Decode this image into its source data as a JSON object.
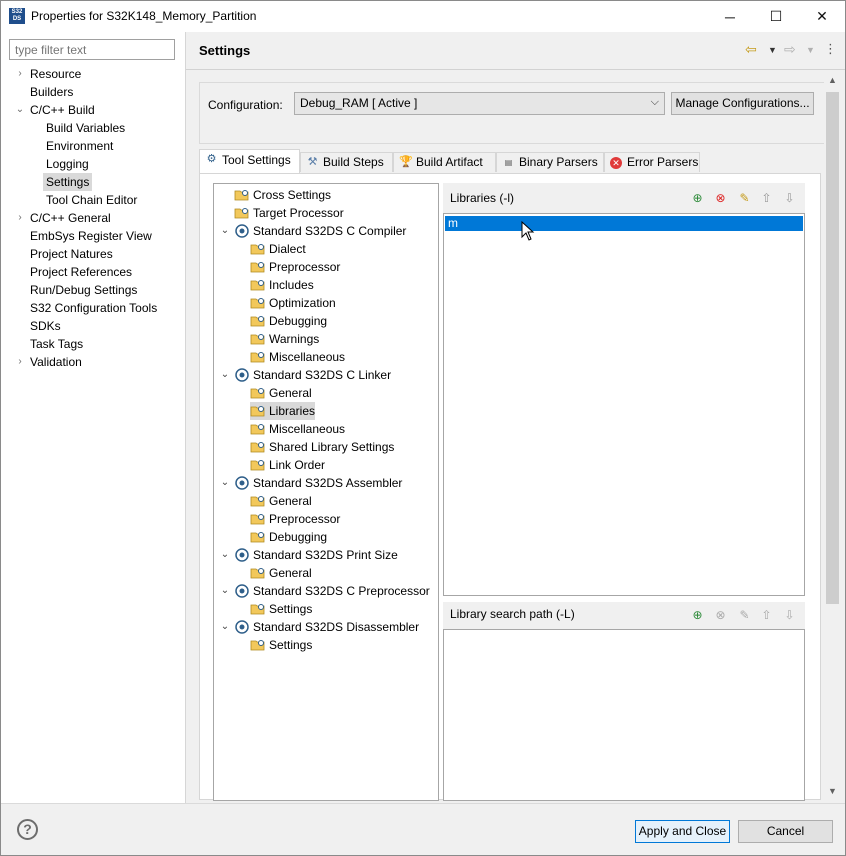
{
  "window": {
    "title": "Properties for S32K148_Memory_Partition",
    "app_icon_text": "S32 DS",
    "minimize": "─",
    "maximize": "☐",
    "close": "✕"
  },
  "filter": {
    "placeholder": "type filter text"
  },
  "sidebar": {
    "items": [
      {
        "label": "Resource",
        "expander": "right"
      },
      {
        "label": "Builders"
      },
      {
        "label": "C/C++ Build",
        "expander": "down"
      },
      {
        "label": "Build Variables"
      },
      {
        "label": "Environment"
      },
      {
        "label": "Logging"
      },
      {
        "label": "Settings",
        "selected": true
      },
      {
        "label": "Tool Chain Editor"
      },
      {
        "label": "C/C++ General",
        "expander": "right"
      },
      {
        "label": "EmbSys Register View"
      },
      {
        "label": "Project Natures"
      },
      {
        "label": "Project References"
      },
      {
        "label": "Run/Debug Settings"
      },
      {
        "label": "S32 Configuration Tools"
      },
      {
        "label": "SDKs"
      },
      {
        "label": "Task Tags"
      },
      {
        "label": "Validation",
        "expander": "right"
      }
    ]
  },
  "header": {
    "title": "Settings"
  },
  "config": {
    "label": "Configuration:",
    "value": "Debug_RAM  [ Active ]",
    "manage_label": "Manage Configurations..."
  },
  "tabs": [
    {
      "label": "Tool Settings",
      "icon": "tool-settings-icon",
      "active": true
    },
    {
      "label": "Build Steps",
      "icon": "build-steps-icon"
    },
    {
      "label": "Build Artifact",
      "icon": "build-artifact-icon"
    },
    {
      "label": "Binary Parsers",
      "icon": "binary-parsers-icon"
    },
    {
      "label": "Error Parsers",
      "icon": "error-parsers-icon"
    }
  ],
  "tool_tree": [
    {
      "label": "Cross Settings"
    },
    {
      "label": "Target Processor"
    },
    {
      "label": "Standard S32DS C Compiler",
      "expander": "down"
    },
    {
      "label": "Dialect"
    },
    {
      "label": "Preprocessor"
    },
    {
      "label": "Includes"
    },
    {
      "label": "Optimization"
    },
    {
      "label": "Debugging"
    },
    {
      "label": "Warnings"
    },
    {
      "label": "Miscellaneous"
    },
    {
      "label": "Standard S32DS C Linker",
      "expander": "down"
    },
    {
      "label": "General"
    },
    {
      "label": "Libraries",
      "selected": true
    },
    {
      "label": "Miscellaneous"
    },
    {
      "label": "Shared Library Settings"
    },
    {
      "label": "Link Order"
    },
    {
      "label": "Standard S32DS Assembler",
      "expander": "down"
    },
    {
      "label": "General"
    },
    {
      "label": "Preprocessor"
    },
    {
      "label": "Debugging"
    },
    {
      "label": "Standard S32DS Print Size",
      "expander": "down"
    },
    {
      "label": "General"
    },
    {
      "label": "Standard S32DS C Preprocessor",
      "expander": "down"
    },
    {
      "label": "Settings"
    },
    {
      "label": "Standard S32DS Disassembler",
      "expander": "down"
    },
    {
      "label": "Settings"
    }
  ],
  "libraries": {
    "title": "Libraries (-l)",
    "items": [
      "m"
    ]
  },
  "library_paths": {
    "title": "Library search path (-L)",
    "items": []
  },
  "footer": {
    "help": "?",
    "apply_close": "Apply and Close",
    "cancel": "Cancel"
  },
  "colors": {
    "selection": "#0078d7",
    "nav_arrow": "#c59b1a"
  }
}
